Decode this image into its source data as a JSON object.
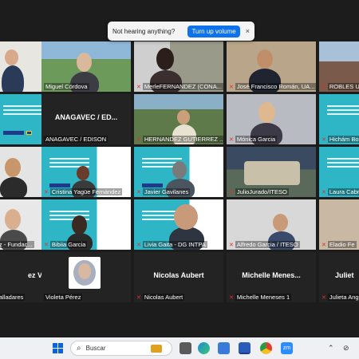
{
  "toast": {
    "message": "Not hearing anything?",
    "button": "Turn up volume",
    "close": "×"
  },
  "participants": [
    {
      "name": "",
      "muted": false
    },
    {
      "name": "Miguel Córdova",
      "muted": false
    },
    {
      "name": "MerleFERNANDEZ (CONA...",
      "muted": true
    },
    {
      "name": "José Francisco Román, UA...",
      "muted": true
    },
    {
      "name": "ROBLES U",
      "muted": true
    },
    {
      "name": "",
      "muted": false
    },
    {
      "name": "ANAGAVEC / EDISON",
      "big": "ANAGAVEC / ED...",
      "muted": false
    },
    {
      "name": "HERNANDEZ GUTIERREZ ...",
      "muted": true
    },
    {
      "name": "Mónica Garcia",
      "muted": true
    },
    {
      "name": "Hichám Bo",
      "muted": true
    },
    {
      "name": "",
      "muted": false
    },
    {
      "name": "Cristina Yagüe Fernández",
      "muted": true
    },
    {
      "name": "Javier Gavilanes",
      "muted": true
    },
    {
      "name": "JulioJurado/ITESO",
      "muted": true
    },
    {
      "name": "Laura Cabr",
      "muted": true
    },
    {
      "name": "z - Fundac...",
      "muted": false
    },
    {
      "name": "Bibiia Garcia",
      "muted": true
    },
    {
      "name": "Livia Gaita - DG INTPA",
      "muted": true
    },
    {
      "name": "Alfredo Garcia / ITESO",
      "muted": true
    },
    {
      "name": "Eladio Fe",
      "muted": true
    },
    {
      "name": "alladares",
      "big": "ez Va...",
      "muted": false
    },
    {
      "name": "Violeta Pérez",
      "muted": false
    },
    {
      "name": "Nicolas Aubert",
      "big": "Nicolas Aubert",
      "muted": true
    },
    {
      "name": "Michelle Meneses 1",
      "big": "Michelle  Menes...",
      "muted": true
    },
    {
      "name": "Julieta Ang",
      "big": "Juliet",
      "muted": true
    }
  ],
  "taskbar": {
    "search_label": "Buscar",
    "apps": [
      "file-explorer",
      "edge",
      "store",
      "word",
      "chrome",
      "zoom"
    ],
    "zoom_label": "zm"
  },
  "colors": {
    "accent": "#0e72ed",
    "mic_muted": "#e0312a",
    "active_border": "#c5e84a"
  }
}
